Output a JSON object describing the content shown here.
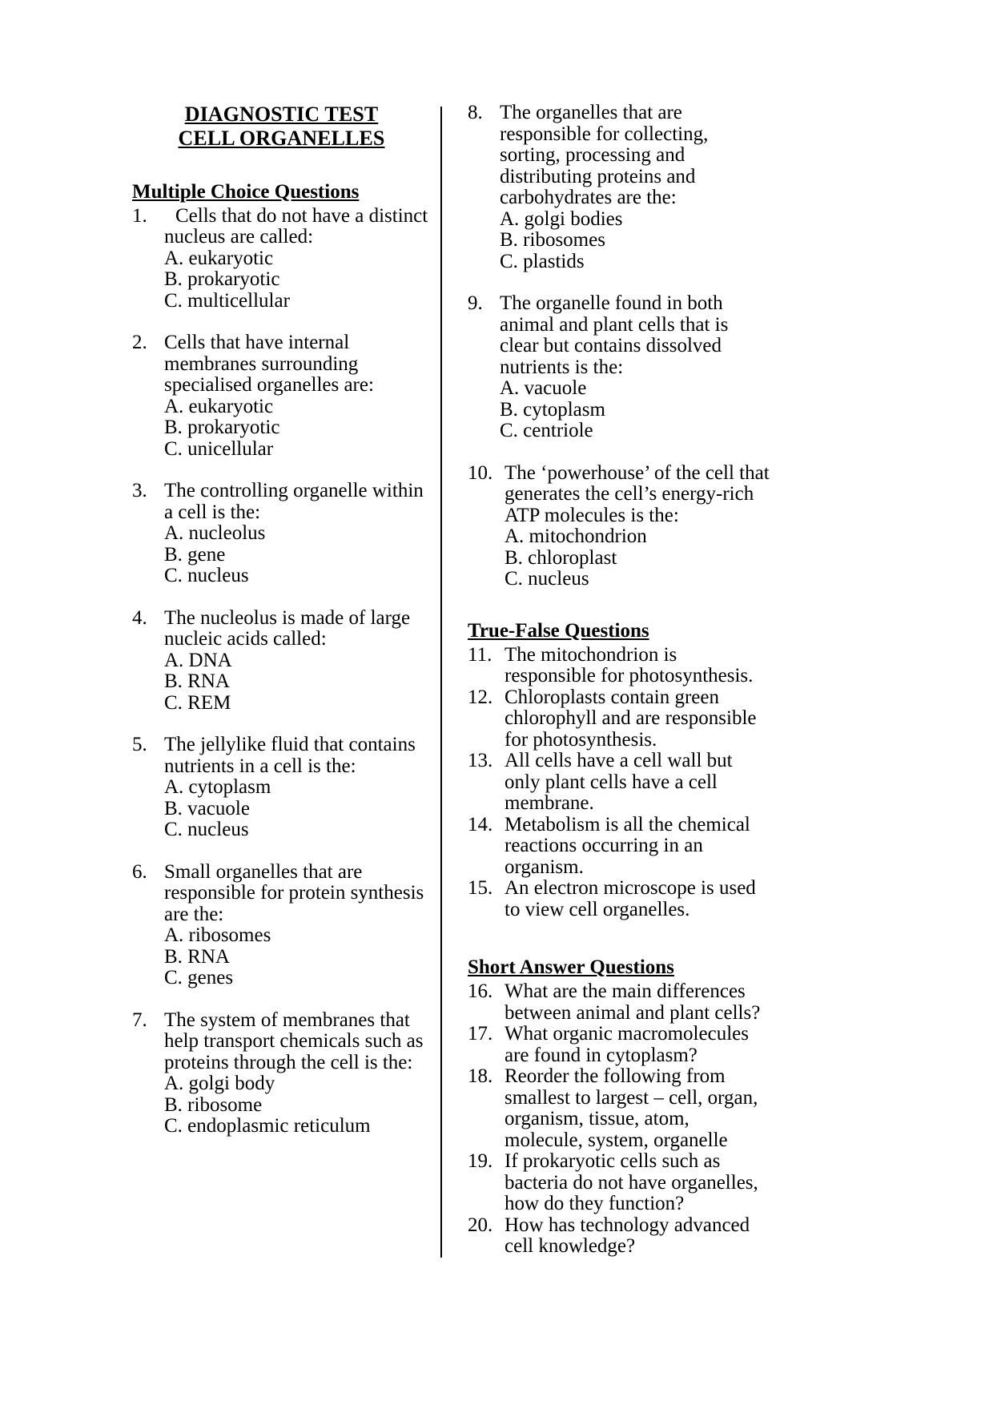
{
  "document": {
    "title_line1": "DIAGNOSTIC TEST",
    "title_line2": "CELL ORGANELLES"
  },
  "sections": {
    "multiple_choice_heading": "Multiple Choice Questions",
    "true_false_heading": "True-False Questions",
    "short_answer_heading": "Short Answer Questions"
  },
  "multiple_choice": [
    {
      "number": "1.",
      "stem": "Cells that do not have a distinct nucleus are called:",
      "options": [
        "A. eukaryotic",
        "B. prokaryotic",
        "C. multicellular"
      ]
    },
    {
      "number": "2.",
      "stem": "Cells that have internal membranes surrounding specialised organelles are:",
      "options": [
        "A. eukaryotic",
        "B. prokaryotic",
        "C. unicellular"
      ]
    },
    {
      "number": "3.",
      "stem": "The controlling organelle within a cell is the:",
      "options": [
        "A. nucleolus",
        "B. gene",
        "C. nucleus"
      ]
    },
    {
      "number": "4.",
      "stem": "The nucleolus is made of large nucleic acids called:",
      "options": [
        "A. DNA",
        "B. RNA",
        "C. REM"
      ]
    },
    {
      "number": "5.",
      "stem": "The jellylike fluid that contains nutrients in a cell is the:",
      "options": [
        "A. cytoplasm",
        "B. vacuole",
        "C. nucleus"
      ]
    },
    {
      "number": "6.",
      "stem": "Small organelles that are responsible for protein synthesis are the:",
      "options": [
        "A. ribosomes",
        "B. RNA",
        "C. genes"
      ]
    },
    {
      "number": "7.",
      "stem": "The system of membranes that help transport chemicals such as proteins through the cell is the:",
      "options": [
        "A. golgi body",
        "B. ribosome",
        "C. endoplasmic reticulum"
      ]
    },
    {
      "number": "8.",
      "stem": "The organelles that are responsible for collecting, sorting, processing and distributing proteins and carbohydrates are the:",
      "options": [
        "A. golgi bodies",
        "B. ribosomes",
        "C. plastids"
      ]
    },
    {
      "number": "9.",
      "stem": "The organelle found in both animal and plant cells that is clear but contains dissolved nutrients is the:",
      "options": [
        "A. vacuole",
        "B. cytoplasm",
        "C. centriole"
      ]
    },
    {
      "number": "10.",
      "stem": "The ‘powerhouse’ of the cell that generates the cell’s energy-rich ATP molecules is the:",
      "options": [
        "A. mitochondrion",
        "B. chloroplast",
        "C. nucleus"
      ]
    }
  ],
  "true_false": [
    {
      "number": "11.",
      "text": "The mitochondrion is responsible for photosynthesis."
    },
    {
      "number": "12.",
      "text": "Chloroplasts contain green chlorophyll and are responsible for photosynthesis."
    },
    {
      "number": "13.",
      "text": "All cells have a cell wall but only plant cells have a cell membrane."
    },
    {
      "number": "14.",
      "text": "Metabolism is all the chemical reactions occurring in an organism."
    },
    {
      "number": "15.",
      "text": "An electron microscope is used to view cell organelles."
    }
  ],
  "short_answer": [
    {
      "number": "16.",
      "text": "What are the main differences between animal and plant cells?"
    },
    {
      "number": "17.",
      "text": "What organic macromolecules are found in cytoplasm?"
    },
    {
      "number": "18.",
      "text": "Reorder the following from smallest to largest – cell, organ, organism, tissue, atom, molecule, system, organelle"
    },
    {
      "number": "19.",
      "text": "If prokaryotic cells such as bacteria do not have organelles, how do they function?"
    },
    {
      "number": "20.",
      "text": "How has technology advanced cell knowledge?"
    }
  ]
}
